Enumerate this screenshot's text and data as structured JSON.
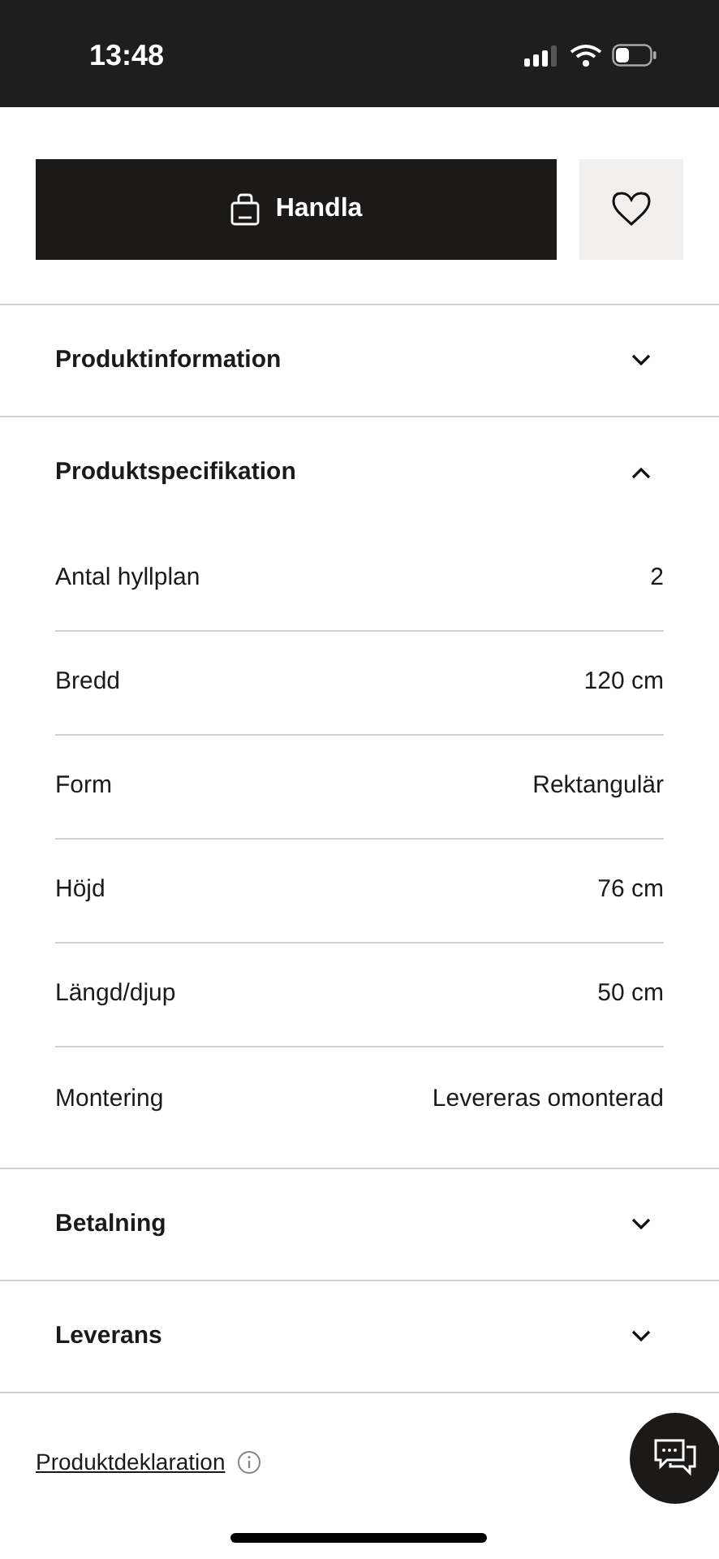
{
  "status_bar": {
    "time": "13:48"
  },
  "buy_button": {
    "label": "Handla"
  },
  "sections": [
    {
      "title": "Produktinformation",
      "expanded": false
    },
    {
      "title": "Produktspecifikation",
      "expanded": true,
      "rows": [
        {
          "label": "Antal hyllplan",
          "value": "2"
        },
        {
          "label": "Bredd",
          "value": "120 cm"
        },
        {
          "label": "Form",
          "value": "Rektangulär"
        },
        {
          "label": "Höjd",
          "value": "76 cm"
        },
        {
          "label": "Längd/djup",
          "value": "50 cm"
        },
        {
          "label": "Montering",
          "value": "Levereras omonterad"
        }
      ]
    },
    {
      "title": "Betalning",
      "expanded": false
    },
    {
      "title": "Leverans",
      "expanded": false
    }
  ],
  "declaration_link": "Produktdeklaration"
}
